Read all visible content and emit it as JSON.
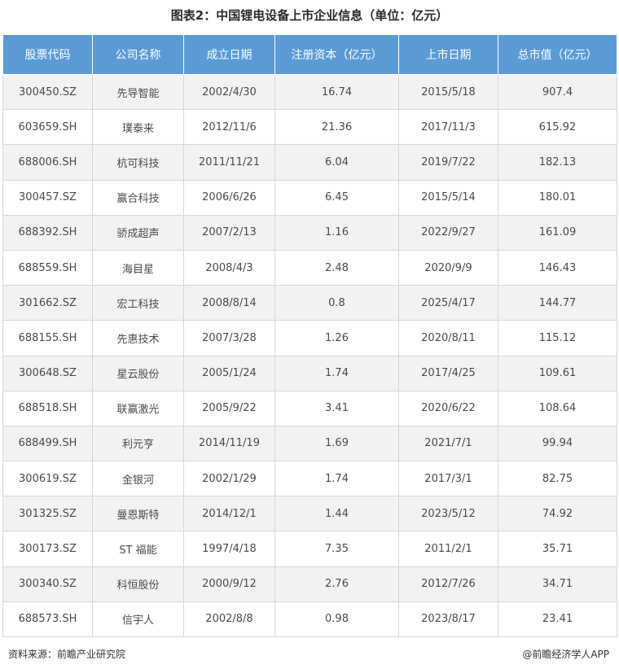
{
  "title": "图表2：中国锂电设备上市企业信息（单位：亿元）",
  "columns": [
    "股票代码",
    "公司名称",
    "成立日期",
    "注册资本（亿元）",
    "上市日期",
    "总市值（亿元）"
  ],
  "rows": [
    [
      "300450.SZ",
      "先导智能",
      "2002/4/30",
      "16.74",
      "2015/5/18",
      "907.4"
    ],
    [
      "603659.SH",
      "璞泰来",
      "2012/11/6",
      "21.36",
      "2017/11/3",
      "615.92"
    ],
    [
      "688006.SH",
      "杭可科技",
      "2011/11/21",
      "6.04",
      "2019/7/22",
      "182.13"
    ],
    [
      "300457.SZ",
      "赢合科技",
      "2006/6/26",
      "6.45",
      "2015/5/14",
      "180.01"
    ],
    [
      "688392.SH",
      "骄成超声",
      "2007/2/13",
      "1.16",
      "2022/9/27",
      "161.09"
    ],
    [
      "688559.SH",
      "海目星",
      "2008/4/3",
      "2.48",
      "2020/9/9",
      "146.43"
    ],
    [
      "301662.SZ",
      "宏工科技",
      "2008/8/14",
      "0.8",
      "2025/4/17",
      "144.77"
    ],
    [
      "688155.SH",
      "先惠技术",
      "2007/3/28",
      "1.26",
      "2020/8/11",
      "115.12"
    ],
    [
      "300648.SZ",
      "星云股份",
      "2005/1/24",
      "1.74",
      "2017/4/25",
      "109.61"
    ],
    [
      "688518.SH",
      "联赢激光",
      "2005/9/22",
      "3.41",
      "2020/6/22",
      "108.64"
    ],
    [
      "688499.SH",
      "利元亨",
      "2014/11/19",
      "1.69",
      "2021/7/1",
      "99.94"
    ],
    [
      "300619.SZ",
      "金银河",
      "2002/1/29",
      "1.74",
      "2017/3/1",
      "82.75"
    ],
    [
      "301325.SZ",
      "曼恩斯特",
      "2014/12/1",
      "1.44",
      "2023/5/12",
      "74.92"
    ],
    [
      "300173.SZ",
      "ST 福能",
      "1997/4/18",
      "7.35",
      "2011/2/1",
      "35.71"
    ],
    [
      "300340.SZ",
      "科恒股份",
      "2000/9/12",
      "2.76",
      "2012/7/26",
      "34.71"
    ],
    [
      "688573.SH",
      "信宇人",
      "2002/8/8",
      "0.98",
      "2023/8/17",
      "23.41"
    ]
  ],
  "footer": {
    "source": "资料来源：前瞻产业研究院",
    "brand": "@前瞻经济学人APP"
  },
  "watermark": "前瞻产业研究院",
  "colors": {
    "header_bg": "#5b9bd5",
    "alt_row_bg": "#f2f2f2"
  }
}
